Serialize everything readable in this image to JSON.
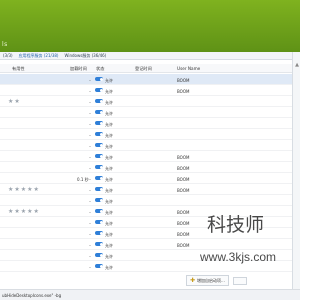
{
  "header": {
    "partial_text": "ls"
  },
  "tabs": [
    {
      "label": "(3/3)"
    },
    {
      "label": "应用程序服务 (21/38)"
    },
    {
      "label": "Windows服务 (36/46)"
    }
  ],
  "columns": {
    "rating": "有用性",
    "delay": "加载时间",
    "state": "状态",
    "time": "登记时间",
    "user": "User Name"
  },
  "rows": [
    {
      "stars": "",
      "delay": "",
      "state": "允许",
      "user": "BOOM",
      "selected": true
    },
    {
      "stars": "",
      "delay": "",
      "state": "允许",
      "user": "BOOM",
      "selected": false
    },
    {
      "stars": "★★",
      "delay": "",
      "state": "允许",
      "user": "",
      "selected": false
    },
    {
      "stars": "",
      "delay": "",
      "state": "允许",
      "user": "",
      "selected": false
    },
    {
      "stars": "",
      "delay": "",
      "state": "允许",
      "user": "",
      "selected": false
    },
    {
      "stars": "",
      "delay": "",
      "state": "允许",
      "user": "",
      "selected": false
    },
    {
      "stars": "",
      "delay": "",
      "state": "允许",
      "user": "",
      "selected": false
    },
    {
      "stars": "",
      "delay": "",
      "state": "允许",
      "user": "BOOM",
      "selected": false
    },
    {
      "stars": "",
      "delay": "",
      "state": "允许",
      "user": "BOOM",
      "selected": false
    },
    {
      "stars": "",
      "delay": "0.1 秒",
      "state": "允许",
      "user": "BOOM",
      "selected": false
    },
    {
      "stars": "★★★★★",
      "delay": "",
      "state": "允许",
      "user": "BOOM",
      "selected": false
    },
    {
      "stars": "",
      "delay": "",
      "state": "允许",
      "user": "",
      "selected": false
    },
    {
      "stars": "★★★★★",
      "delay": "",
      "state": "允许",
      "user": "BOOM",
      "selected": false
    },
    {
      "stars": "",
      "delay": "",
      "state": "允许",
      "user": "BOOM",
      "selected": false
    },
    {
      "stars": "",
      "delay": "",
      "state": "允许",
      "user": "BOOM",
      "selected": false
    },
    {
      "stars": "",
      "delay": "",
      "state": "允许",
      "user": "BOOM",
      "selected": false
    },
    {
      "stars": "",
      "delay": "",
      "state": "允许",
      "user": "",
      "selected": false
    },
    {
      "stars": "",
      "delay": "",
      "state": "允许",
      "user": "",
      "selected": false
    }
  ],
  "toolbar": {
    "add_label": "增加自启动项..."
  },
  "status": {
    "path": "ubHideDesktopIcons.exe\" -bg"
  },
  "watermark": {
    "text": "科技师",
    "url": "www.3kjs.com"
  },
  "colors": {
    "header_green": "#7fb21f",
    "toggle_blue": "#2f7fd8"
  }
}
